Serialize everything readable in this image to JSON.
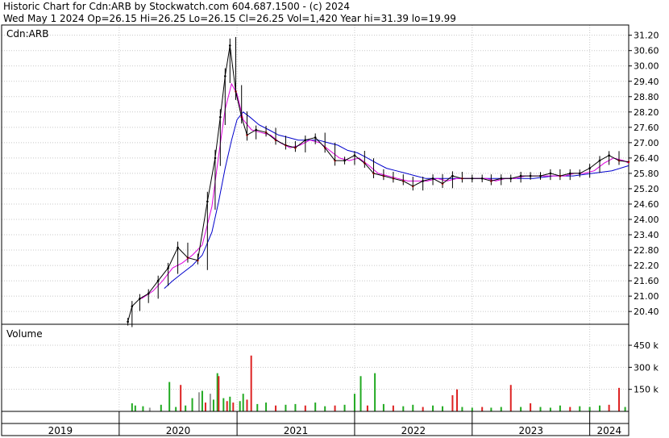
{
  "header": {
    "line1": "Historic Chart for Cdn:ARB by Stockwatch.com 604.687.1500 - (c) 2024",
    "line2": "Wed May  1 2024   Op=26.15   Hi=26.25   Lo=26.15   Cl=26.25   Vol=1,420   Year hi=31.39   lo=19.99"
  },
  "colors": {
    "price": "#000000",
    "down_tick": "#dd0000",
    "ma_short": "#dd00dd",
    "ma_long": "#0000cc",
    "vol_up": "#22aa22",
    "vol_down": "#dd2222",
    "vol_flat": "#999999",
    "grid": "#c8c8c8"
  },
  "chart_data": [
    {
      "type": "line",
      "title": "Cdn:ARB",
      "ylim": [
        19.9,
        31.6
      ],
      "y_ticks": [
        "20.40",
        "21.00",
        "21.60",
        "22.20",
        "22.80",
        "23.40",
        "24.00",
        "24.60",
        "25.20",
        "25.80",
        "26.40",
        "27.00",
        "27.60",
        "28.20",
        "28.80",
        "29.40",
        "30.00",
        "30.60",
        "31.20"
      ],
      "x_ticks": [
        "2019",
        "2020",
        "2021",
        "2022",
        "2023",
        "2024"
      ],
      "x_range": [
        "2019-01-01",
        "2024-05-01"
      ],
      "series": [
        {
          "key": "price",
          "points": [
            [
              "2020-01-28",
              20.0
            ],
            [
              "2020-02-10",
              20.6
            ],
            [
              "2020-03-05",
              20.9
            ],
            [
              "2020-04-01",
              21.1
            ],
            [
              "2020-05-01",
              21.6
            ],
            [
              "2020-06-01",
              22.1
            ],
            [
              "2020-07-01",
              22.9
            ],
            [
              "2020-08-01",
              22.5
            ],
            [
              "2020-09-01",
              22.4
            ],
            [
              "2020-10-01",
              24.7
            ],
            [
              "2020-10-25",
              26.4
            ],
            [
              "2020-11-10",
              28.0
            ],
            [
              "2020-11-25",
              29.6
            ],
            [
              "2020-12-10",
              30.8
            ],
            [
              "2020-12-28",
              29.0
            ],
            [
              "2021-01-15",
              28.0
            ],
            [
              "2021-02-01",
              27.3
            ],
            [
              "2021-03-01",
              27.5
            ],
            [
              "2021-04-01",
              27.4
            ],
            [
              "2021-05-01",
              27.1
            ],
            [
              "2021-06-01",
              26.9
            ],
            [
              "2021-07-01",
              26.8
            ],
            [
              "2021-08-01",
              27.1
            ],
            [
              "2021-09-01",
              27.2
            ],
            [
              "2021-10-01",
              26.8
            ],
            [
              "2021-11-01",
              26.3
            ],
            [
              "2021-12-01",
              26.3
            ],
            [
              "2022-01-01",
              26.5
            ],
            [
              "2022-02-01",
              26.2
            ],
            [
              "2022-03-01",
              25.8
            ],
            [
              "2022-04-01",
              25.7
            ],
            [
              "2022-05-01",
              25.6
            ],
            [
              "2022-06-01",
              25.5
            ],
            [
              "2022-07-01",
              25.3
            ],
            [
              "2022-08-01",
              25.5
            ],
            [
              "2022-09-01",
              25.6
            ],
            [
              "2022-10-01",
              25.4
            ],
            [
              "2022-11-01",
              25.7
            ],
            [
              "2022-12-01",
              25.6
            ],
            [
              "2023-01-01",
              25.6
            ],
            [
              "2023-02-01",
              25.6
            ],
            [
              "2023-03-01",
              25.5
            ],
            [
              "2023-04-01",
              25.6
            ],
            [
              "2023-05-01",
              25.6
            ],
            [
              "2023-06-01",
              25.7
            ],
            [
              "2023-07-01",
              25.7
            ],
            [
              "2023-08-01",
              25.7
            ],
            [
              "2023-09-01",
              25.8
            ],
            [
              "2023-10-01",
              25.7
            ],
            [
              "2023-11-01",
              25.8
            ],
            [
              "2023-12-01",
              25.8
            ],
            [
              "2024-01-01",
              26.0
            ],
            [
              "2024-02-01",
              26.3
            ],
            [
              "2024-03-01",
              26.5
            ],
            [
              "2024-04-01",
              26.3
            ],
            [
              "2024-05-01",
              26.25
            ]
          ]
        },
        {
          "key": "ma_short",
          "points": [
            [
              "2020-03-10",
              20.9
            ],
            [
              "2020-04-15",
              21.2
            ],
            [
              "2020-05-15",
              21.6
            ],
            [
              "2020-06-15",
              22.1
            ],
            [
              "2020-07-15",
              22.3
            ],
            [
              "2020-08-15",
              22.6
            ],
            [
              "2020-09-15",
              23.0
            ],
            [
              "2020-10-15",
              24.5
            ],
            [
              "2020-11-05",
              26.5
            ],
            [
              "2020-11-25",
              28.3
            ],
            [
              "2020-12-15",
              29.3
            ],
            [
              "2021-01-01",
              28.9
            ],
            [
              "2021-01-20",
              27.9
            ],
            [
              "2021-02-15",
              27.5
            ],
            [
              "2021-03-15",
              27.4
            ],
            [
              "2021-04-15",
              27.3
            ],
            [
              "2021-05-15",
              27.0
            ],
            [
              "2021-06-15",
              26.8
            ],
            [
              "2021-07-15",
              26.9
            ],
            [
              "2021-08-15",
              27.1
            ],
            [
              "2021-09-15",
              27.0
            ],
            [
              "2021-10-15",
              26.7
            ],
            [
              "2021-11-15",
              26.4
            ],
            [
              "2021-12-15",
              26.3
            ],
            [
              "2022-01-15",
              26.4
            ],
            [
              "2022-02-15",
              26.1
            ],
            [
              "2022-03-15",
              25.8
            ],
            [
              "2022-04-15",
              25.7
            ],
            [
              "2022-05-15",
              25.6
            ],
            [
              "2022-06-15",
              25.5
            ],
            [
              "2022-07-15",
              25.5
            ],
            [
              "2022-08-15",
              25.5
            ],
            [
              "2022-09-15",
              25.6
            ],
            [
              "2022-10-15",
              25.5
            ],
            [
              "2022-11-15",
              25.6
            ],
            [
              "2022-12-15",
              25.6
            ],
            [
              "2023-01-15",
              25.6
            ],
            [
              "2023-02-15",
              25.6
            ],
            [
              "2023-03-15",
              25.5
            ],
            [
              "2023-04-15",
              25.6
            ],
            [
              "2023-05-15",
              25.6
            ],
            [
              "2023-06-15",
              25.7
            ],
            [
              "2023-07-15",
              25.7
            ],
            [
              "2023-08-15",
              25.7
            ],
            [
              "2023-09-15",
              25.7
            ],
            [
              "2023-10-15",
              25.7
            ],
            [
              "2023-11-15",
              25.8
            ],
            [
              "2023-12-15",
              25.8
            ],
            [
              "2024-01-15",
              25.9
            ],
            [
              "2024-02-15",
              26.2
            ],
            [
              "2024-03-15",
              26.4
            ],
            [
              "2024-04-15",
              26.3
            ],
            [
              "2024-05-01",
              26.2
            ]
          ]
        },
        {
          "key": "ma_long",
          "points": [
            [
              "2020-05-20",
              21.3
            ],
            [
              "2020-06-15",
              21.6
            ],
            [
              "2020-07-15",
              21.9
            ],
            [
              "2020-08-15",
              22.2
            ],
            [
              "2020-09-15",
              22.6
            ],
            [
              "2020-10-15",
              23.5
            ],
            [
              "2020-11-05",
              24.7
            ],
            [
              "2020-11-25",
              26.0
            ],
            [
              "2020-12-15",
              27.1
            ],
            [
              "2021-01-01",
              27.9
            ],
            [
              "2021-01-20",
              28.2
            ],
            [
              "2021-02-10",
              28.0
            ],
            [
              "2021-03-10",
              27.7
            ],
            [
              "2021-04-10",
              27.5
            ],
            [
              "2021-05-10",
              27.3
            ],
            [
              "2021-06-10",
              27.2
            ],
            [
              "2021-07-10",
              27.1
            ],
            [
              "2021-08-10",
              27.1
            ],
            [
              "2021-09-10",
              27.1
            ],
            [
              "2021-10-10",
              27.0
            ],
            [
              "2021-11-10",
              26.9
            ],
            [
              "2021-12-10",
              26.7
            ],
            [
              "2022-01-10",
              26.6
            ],
            [
              "2022-02-10",
              26.4
            ],
            [
              "2022-03-10",
              26.2
            ],
            [
              "2022-04-10",
              26.0
            ],
            [
              "2022-05-10",
              25.9
            ],
            [
              "2022-06-10",
              25.8
            ],
            [
              "2022-07-10",
              25.7
            ],
            [
              "2022-08-10",
              25.6
            ],
            [
              "2022-09-10",
              25.6
            ],
            [
              "2022-10-10",
              25.6
            ],
            [
              "2022-11-10",
              25.6
            ],
            [
              "2022-12-10",
              25.6
            ],
            [
              "2023-01-10",
              25.6
            ],
            [
              "2023-03-10",
              25.6
            ],
            [
              "2023-05-10",
              25.6
            ],
            [
              "2023-07-10",
              25.6
            ],
            [
              "2023-09-10",
              25.7
            ],
            [
              "2023-11-10",
              25.7
            ],
            [
              "2024-01-10",
              25.8
            ],
            [
              "2024-03-10",
              25.9
            ],
            [
              "2024-05-01",
              26.1
            ]
          ]
        }
      ]
    },
    {
      "type": "bar",
      "title": "Volume",
      "ylim": [
        0,
        560
      ],
      "y_ticks": [
        "150 k",
        "300 k",
        "450 k"
      ],
      "y_tick_values": [
        150,
        300,
        450
      ],
      "bars": [
        [
          "2020-02-10",
          55,
          "up"
        ],
        [
          "2020-02-20",
          40,
          "up"
        ],
        [
          "2020-03-15",
          35,
          "up"
        ],
        [
          "2020-04-05",
          25,
          "flat"
        ],
        [
          "2020-05-10",
          45,
          "up"
        ],
        [
          "2020-06-05",
          200,
          "up"
        ],
        [
          "2020-06-25",
          30,
          "up"
        ],
        [
          "2020-07-10",
          180,
          "down"
        ],
        [
          "2020-07-25",
          40,
          "up"
        ],
        [
          "2020-08-15",
          90,
          "up"
        ],
        [
          "2020-09-05",
          130,
          "flat"
        ],
        [
          "2020-09-15",
          140,
          "up"
        ],
        [
          "2020-09-25",
          60,
          "down"
        ],
        [
          "2020-10-10",
          120,
          "flat"
        ],
        [
          "2020-10-20",
          80,
          "up"
        ],
        [
          "2020-11-01",
          260,
          "up"
        ],
        [
          "2020-11-05",
          240,
          "down"
        ],
        [
          "2020-11-20",
          90,
          "up"
        ],
        [
          "2020-12-01",
          70,
          "down"
        ],
        [
          "2020-12-10",
          100,
          "up"
        ],
        [
          "2020-12-20",
          60,
          "down"
        ],
        [
          "2021-01-10",
          70,
          "up"
        ],
        [
          "2021-01-20",
          120,
          "up"
        ],
        [
          "2021-02-01",
          80,
          "down"
        ],
        [
          "2021-02-14",
          380,
          "down"
        ],
        [
          "2021-03-05",
          50,
          "up"
        ],
        [
          "2021-04-01",
          60,
          "up"
        ],
        [
          "2021-05-01",
          40,
          "down"
        ],
        [
          "2021-06-01",
          45,
          "up"
        ],
        [
          "2021-07-01",
          50,
          "up"
        ],
        [
          "2021-08-01",
          40,
          "down"
        ],
        [
          "2021-09-01",
          60,
          "up"
        ],
        [
          "2021-10-01",
          35,
          "up"
        ],
        [
          "2021-11-01",
          40,
          "down"
        ],
        [
          "2021-12-01",
          45,
          "up"
        ],
        [
          "2022-01-01",
          120,
          "up"
        ],
        [
          "2022-01-20",
          240,
          "up"
        ],
        [
          "2022-02-10",
          40,
          "down"
        ],
        [
          "2022-03-05",
          260,
          "up"
        ],
        [
          "2022-04-01",
          50,
          "up"
        ],
        [
          "2022-05-01",
          40,
          "down"
        ],
        [
          "2022-06-01",
          35,
          "up"
        ],
        [
          "2022-07-01",
          45,
          "up"
        ],
        [
          "2022-08-01",
          30,
          "down"
        ],
        [
          "2022-09-01",
          40,
          "up"
        ],
        [
          "2022-10-01",
          35,
          "up"
        ],
        [
          "2022-11-01",
          110,
          "down"
        ],
        [
          "2022-11-15",
          150,
          "down"
        ],
        [
          "2022-12-01",
          30,
          "up"
        ],
        [
          "2023-01-01",
          25,
          "up"
        ],
        [
          "2023-02-01",
          30,
          "down"
        ],
        [
          "2023-03-01",
          25,
          "up"
        ],
        [
          "2023-04-01",
          30,
          "up"
        ],
        [
          "2023-05-01",
          180,
          "down"
        ],
        [
          "2023-06-01",
          30,
          "up"
        ],
        [
          "2023-07-01",
          55,
          "down"
        ],
        [
          "2023-08-01",
          30,
          "up"
        ],
        [
          "2023-09-01",
          25,
          "up"
        ],
        [
          "2023-10-01",
          40,
          "up"
        ],
        [
          "2023-11-01",
          30,
          "down"
        ],
        [
          "2023-12-01",
          35,
          "up"
        ],
        [
          "2024-01-01",
          30,
          "up"
        ],
        [
          "2024-02-01",
          40,
          "up"
        ],
        [
          "2024-03-01",
          45,
          "down"
        ],
        [
          "2024-04-01",
          160,
          "down"
        ],
        [
          "2024-04-20",
          30,
          "up"
        ]
      ]
    }
  ]
}
